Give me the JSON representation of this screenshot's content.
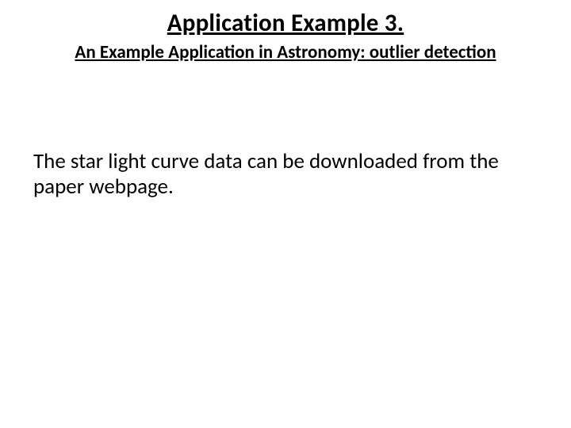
{
  "title": "Application Example 3.",
  "subtitle": "An Example Application in Astronomy: outlier detection",
  "body": "The star light curve data can be downloaded from the paper webpage."
}
